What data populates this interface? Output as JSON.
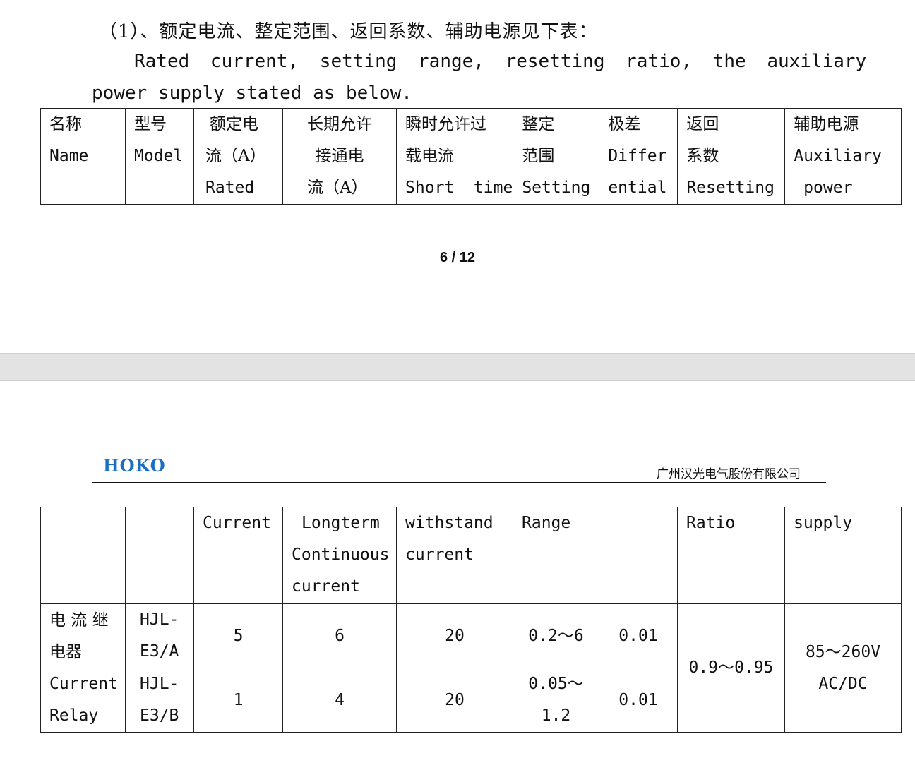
{
  "intro": {
    "heading_cn": "（1）、额定电流、整定范围、返回系数、辅助电源见下表：",
    "line1_en": "Rated current, setting range, resetting ratio, the auxiliary",
    "line2_en": "power supply stated as below."
  },
  "table_top": {
    "headers": [
      [
        "名称",
        "Name",
        ""
      ],
      [
        "型号",
        "Model",
        ""
      ],
      [
        "额定电",
        "流（A）",
        "Rated"
      ],
      [
        "长期允许",
        "接通电",
        "流（A）"
      ],
      [
        "瞬时允许过",
        "载电流",
        "Short  time"
      ],
      [
        "整定",
        "范围",
        "Setting"
      ],
      [
        "极差",
        "Differ",
        "ential"
      ],
      [
        "返回",
        "系数",
        "Resetting"
      ],
      [
        "辅助电源",
        "Auxiliary",
        " power"
      ]
    ]
  },
  "page_number": "6 / 12",
  "header": {
    "logo": "HOKO",
    "company": "广州汉光电气股份有限公司"
  },
  "table_bottom": {
    "headers": [
      [
        "",
        "",
        ""
      ],
      [
        "",
        "",
        ""
      ],
      [
        "Current",
        "",
        ""
      ],
      [
        "Longterm",
        "Continuous",
        "current"
      ],
      [
        "withstand",
        "current",
        ""
      ],
      [
        "Range",
        "",
        ""
      ],
      [
        "",
        "",
        ""
      ],
      [
        "Ratio",
        "",
        ""
      ],
      [
        "supply",
        "",
        ""
      ]
    ],
    "name_cell": [
      "电 流 继",
      "电器",
      "Current",
      "Relay"
    ],
    "rows": [
      {
        "model": [
          "HJL-",
          "E3/A"
        ],
        "rated": "5",
        "longterm": "6",
        "short_time": "20",
        "setting": [
          "0.2～6"
        ],
        "differential": "0.01"
      },
      {
        "model": [
          "HJL-",
          "E3/B"
        ],
        "rated": "1",
        "longterm": "4",
        "short_time": "20",
        "setting": [
          "0.05～",
          "1.2"
        ],
        "differential": "0.01"
      }
    ],
    "resetting_ratio": "0.9～0.95",
    "aux_supply": [
      "85～260V",
      "AC/DC"
    ]
  }
}
